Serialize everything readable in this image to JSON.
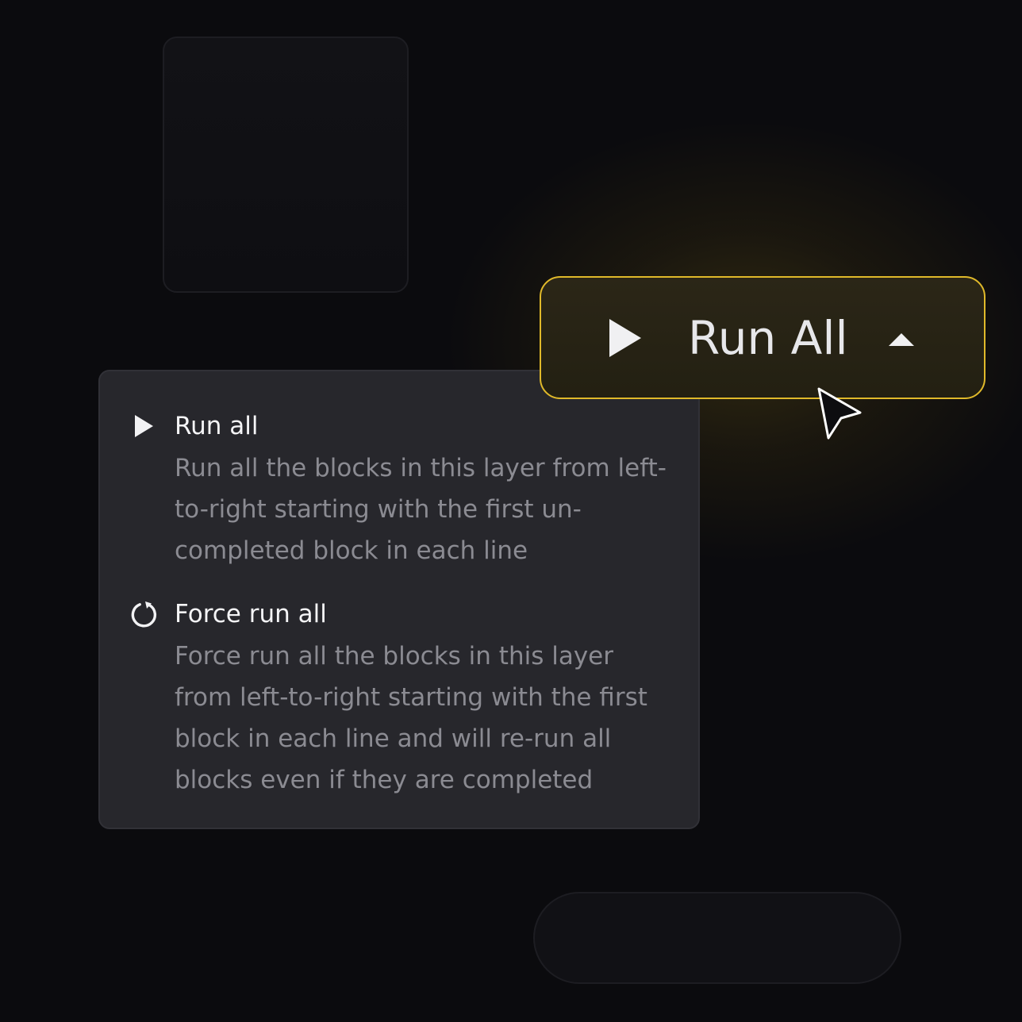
{
  "run_button": {
    "label": "Run All",
    "play_icon": "play-icon",
    "caret_icon": "caret-up-icon",
    "border_color": "#e0b92a"
  },
  "menu": {
    "items": [
      {
        "icon": "play-icon",
        "title": "Run all",
        "description": "Run all the blocks in this layer from left-to-right starting with the first un-completed block in each line"
      },
      {
        "icon": "refresh-icon",
        "title": "Force run all",
        "description": "Force run all the blocks in this layer from left-to-right starting with the first block in each line and will re-run all blocks even if they are completed"
      }
    ]
  },
  "cursor": {
    "icon": "cursor-arrow-icon"
  },
  "colors": {
    "background": "#0b0b0e",
    "menu_background": "#27272c",
    "accent": "#e0b92a",
    "title_text": "#f4f4f6",
    "description_text": "#8b8b92"
  }
}
